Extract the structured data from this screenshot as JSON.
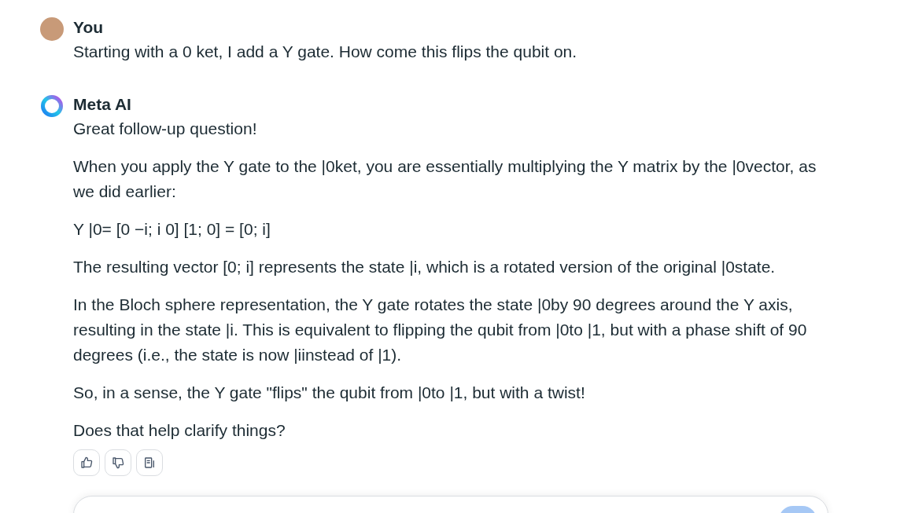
{
  "messages": [
    {
      "kind": "user",
      "author": "You",
      "paragraphs": [
        "Starting with a 0 ket, I add a Y gate. How come this flips the qubit on."
      ]
    },
    {
      "kind": "assistant",
      "author": "Meta AI",
      "paragraphs": [
        "Great follow-up question!",
        "When you apply the Y gate to the |0ket, you are essentially multiplying the Y matrix by the |0vector, as we did earlier:",
        "Y |0= [0 −i; i 0] [1; 0] = [0; i]",
        "The resulting vector [0; i] represents the state |i, which is a rotated version of the original |0state.",
        "In the Bloch sphere representation, the Y gate rotates the state |0by 90 degrees around the Y axis, resulting in the state |i. This is equivalent to flipping the qubit from |0to |1, but with a phase shift of 90 degrees (i.e., the state is now |iinstead of |1).",
        "So, in a sense, the Y gate \"flips\" the qubit from |0to |1, but with a twist!",
        "Does that help clarify things?"
      ]
    }
  ]
}
